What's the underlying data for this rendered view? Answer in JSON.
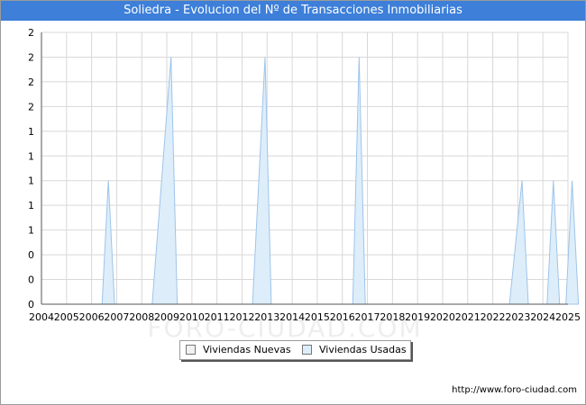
{
  "title": "Soliedra - Evolucion del Nº de Transacciones Inmobiliarias",
  "credit": "http://www.foro-ciudad.com",
  "colors": {
    "title_bg": "#3d7fd9",
    "usadas_fill": "#ddeefa",
    "usadas_line": "#9ec4ea",
    "nuevas_fill": "#f2f2f2",
    "grid": "#d8d8d8"
  },
  "chart_data": {
    "type": "area",
    "title": "Soliedra - Evolucion del Nº de Transacciones Inmobiliarias",
    "xlabel": "",
    "ylabel": "",
    "x_ticks": [
      "2004",
      "2005",
      "2006",
      "2007",
      "2008",
      "2009",
      "2010",
      "2011",
      "2012",
      "2013",
      "2014",
      "2015",
      "2016",
      "2017",
      "2018",
      "2019",
      "2020",
      "2021",
      "2022",
      "2023",
      "2024",
      "2025"
    ],
    "y_tick_labels": [
      "0",
      "0",
      "0",
      "1",
      "1",
      "1",
      "1",
      "1",
      "2",
      "2",
      "2",
      "2"
    ],
    "ylim": [
      0,
      2.2
    ],
    "grid": true,
    "legend_position": "bottom",
    "series": [
      {
        "name": "Viviendas Nuevas",
        "points": []
      },
      {
        "name": "Viviendas Usadas",
        "points": [
          {
            "x": "2006-06",
            "y": 0
          },
          {
            "x": "2006-09",
            "y": 1
          },
          {
            "x": "2006-12",
            "y": 0
          },
          {
            "x": "2008-06",
            "y": 0
          },
          {
            "x": "2009-03",
            "y": 2
          },
          {
            "x": "2009-06",
            "y": 0
          },
          {
            "x": "2012-06",
            "y": 0
          },
          {
            "x": "2012-12",
            "y": 2
          },
          {
            "x": "2013-03",
            "y": 0
          },
          {
            "x": "2016-06",
            "y": 0
          },
          {
            "x": "2016-09",
            "y": 2
          },
          {
            "x": "2016-12",
            "y": 0
          },
          {
            "x": "2022-09",
            "y": 0
          },
          {
            "x": "2023-03",
            "y": 1
          },
          {
            "x": "2023-06",
            "y": 0
          },
          {
            "x": "2024-03",
            "y": 0
          },
          {
            "x": "2024-06",
            "y": 1
          },
          {
            "x": "2024-09",
            "y": 0
          },
          {
            "x": "2024-12",
            "y": 0
          },
          {
            "x": "2025-03",
            "y": 1
          },
          {
            "x": "2025-06",
            "y": 0
          }
        ]
      }
    ]
  },
  "legend": {
    "nuevas_label": "Viviendas Nuevas",
    "usadas_label": "Viviendas Usadas"
  },
  "watermark": "FORO-CIUDAD.COM"
}
